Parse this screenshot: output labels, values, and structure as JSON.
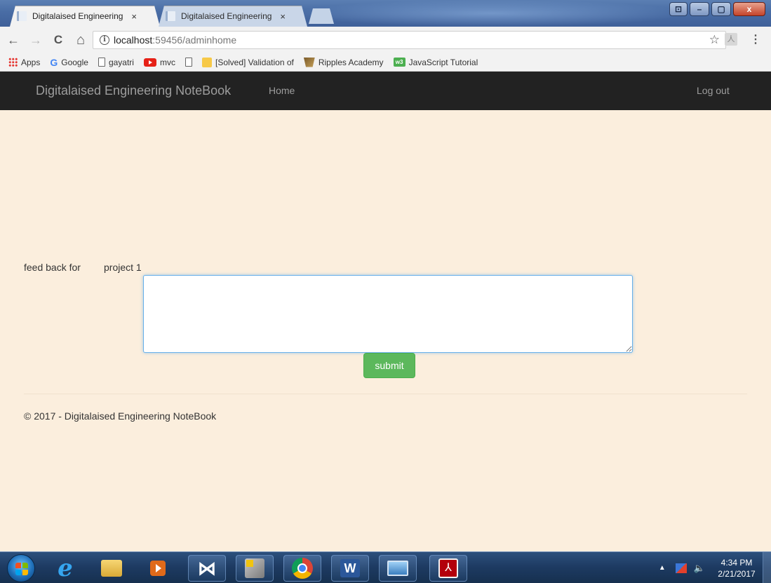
{
  "browser": {
    "tabs": [
      {
        "label": "Digitalaised Engineering",
        "close": "×",
        "active": true
      },
      {
        "label": "Digitalaised Engineering",
        "close": "×",
        "active": false
      }
    ],
    "window_controls": {
      "minimize": "–",
      "maximize": "▢",
      "close": "x"
    },
    "nav": {
      "back": "←",
      "forward": "→",
      "reload": "C",
      "home": "⌂"
    },
    "address": {
      "info_icon": "i",
      "host": "localhost",
      "path": ":59456/adminhome",
      "star": "☆"
    },
    "menu_dots": "⋮",
    "extension_icon_label": "人",
    "bookmarks": [
      {
        "icon": "apps-grid-icon",
        "label": "Apps"
      },
      {
        "icon": "google-g-icon",
        "label": "Google",
        "icon_text": "G"
      },
      {
        "icon": "page-icon",
        "label": "gayatri"
      },
      {
        "icon": "youtube-icon",
        "label": "mvc"
      },
      {
        "icon": "page-icon",
        "label": ""
      },
      {
        "icon": "stackoverflow-icon",
        "label": "[Solved] Validation of"
      },
      {
        "icon": "ripples-icon",
        "label": "Ripples Academy"
      },
      {
        "icon": "w3schools-icon",
        "label": "JavaScript Tutorial",
        "icon_text": "w3"
      }
    ]
  },
  "navbar": {
    "brand": "Digitalaised Engineering NoteBook",
    "home": "Home",
    "logout": "Log out"
  },
  "form": {
    "feedback_label": "feed back for",
    "project_label": "project 1",
    "textarea_value": "",
    "submit_label": "submit"
  },
  "footer": {
    "text": "© 2017 - Digitalaised Engineering NoteBook"
  },
  "taskbar": {
    "apps": [
      "internet-explorer",
      "file-explorer",
      "media-player",
      "visual-studio",
      "tools",
      "chrome",
      "word",
      "screen-capture",
      "acrobat"
    ],
    "ie_glyph": "e",
    "vs_glyph": "⋈",
    "word_glyph": "W",
    "pdf_glyph": "⅄",
    "tray_arrow": "▲",
    "volume_glyph": "🔈",
    "clock_time": "4:34 PM",
    "clock_date": "2/21/2017"
  },
  "colors": {
    "page_bg": "#fbeedd",
    "navbar_bg": "#222222",
    "submit_bg": "#5cb85c",
    "textarea_focus": "#66afe9"
  }
}
